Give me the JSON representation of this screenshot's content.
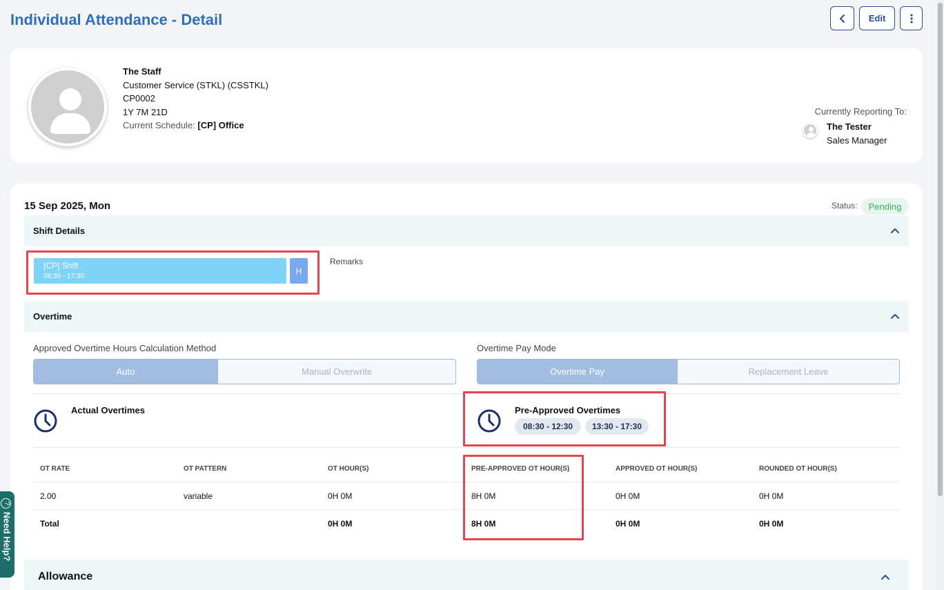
{
  "page": {
    "title": "Individual Attendance - Detail"
  },
  "toolbar": {
    "edit_label": "Edit",
    "back_icon": "chevron-left-icon",
    "more_icon": "more-vertical-icon"
  },
  "profile": {
    "name": "The Staff",
    "department": "Customer Service (STKL) (CSSTKL)",
    "code": "CP0002",
    "tenure": "1Y 7M 21D",
    "schedule_label": "Current Schedule:",
    "schedule_value": "[CP] Office",
    "reporting_label": "Currently Reporting To:",
    "manager_name": "The Tester",
    "manager_role": "Sales Manager"
  },
  "detail": {
    "date": "15 Sep 2025, Mon",
    "status_label": "Status:",
    "status_value": "Pending",
    "status_color": "#34b25a"
  },
  "shift": {
    "section_title": "Shift Details",
    "name": "[CP] Shift",
    "time": "08:30 - 17:30",
    "tag": "H",
    "remarks_label": "Remarks"
  },
  "overtime": {
    "section_title": "Overtime",
    "calc_label": "Approved Overtime Hours Calculation Method",
    "calc_options": [
      "Auto",
      "Manual Overwrite"
    ],
    "calc_selected": "Auto",
    "pay_label": "Overtime Pay Mode",
    "pay_options": [
      "Overtime Pay",
      "Replacement Leave"
    ],
    "pay_selected": "Overtime Pay",
    "actual_title": "Actual Overtimes",
    "preapproved_title": "Pre-Approved Overtimes",
    "preapproved_slots": [
      "08:30 - 12:30",
      "13:30 - 17:30"
    ],
    "table": {
      "headers": [
        "OT RATE",
        "OT PATTERN",
        "OT HOUR(S)",
        "PRE-APPROVED OT HOUR(S)",
        "APPROVED OT HOUR(S)",
        "ROUNDED OT HOUR(S)"
      ],
      "rows": [
        [
          "2.00",
          "variable",
          "0H 0M",
          "8H 0M",
          "0H 0M",
          "0H 0M"
        ]
      ],
      "total": [
        "Total",
        "",
        "0H 0M",
        "8H 0M",
        "0H 0M",
        "0H 0M"
      ]
    }
  },
  "allowance": {
    "section_title": "Allowance"
  },
  "help": {
    "label": "Need Help?"
  },
  "colors": {
    "accent": "#2f6fba",
    "highlight": "#e3474d",
    "section_bg": "#edf7f6"
  }
}
